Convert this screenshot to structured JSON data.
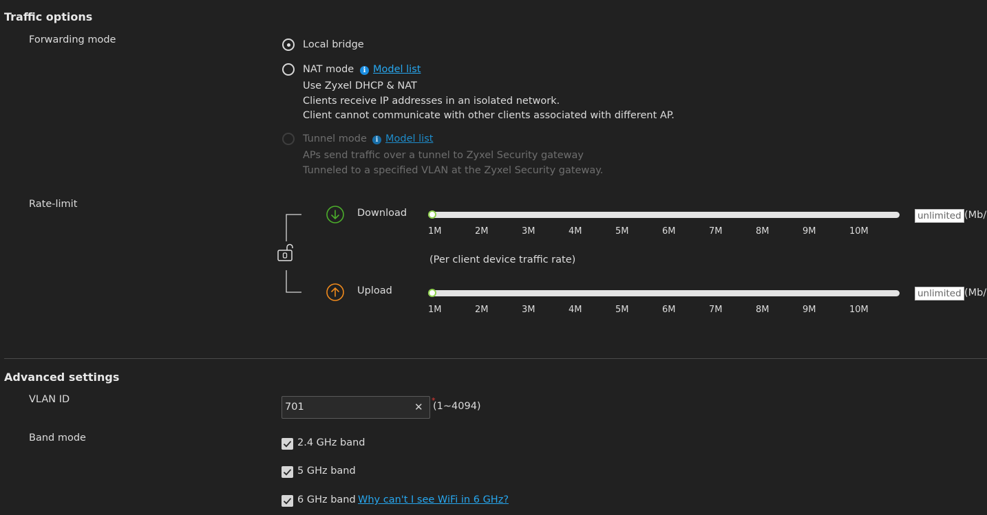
{
  "traffic": {
    "title": "Traffic options",
    "forwarding_label": "Forwarding mode",
    "options": [
      {
        "label": "Local bridge",
        "selected": true,
        "disabled": false
      },
      {
        "label": "NAT mode",
        "link": "Model list",
        "selected": false,
        "disabled": false,
        "desc": [
          "Use Zyxel DHCP & NAT",
          "Clients receive IP addresses in an isolated network.",
          "Client cannot communicate with other clients associated with different AP."
        ]
      },
      {
        "label": "Tunnel mode",
        "link": "Model list",
        "selected": false,
        "disabled": true,
        "desc": [
          "APs send traffic over a tunnel to Zyxel Security gateway",
          "Tunneled to a specified VLAN at the Zyxel Security gateway."
        ]
      }
    ],
    "info_glyph": "i",
    "rate_limit_label": "Rate-limit",
    "download_label": "Download",
    "upload_label": "Upload",
    "ticks": [
      "1M",
      "2M",
      "3M",
      "4M",
      "5M",
      "6M",
      "7M",
      "8M",
      "9M",
      "10M"
    ],
    "download_value": "unlimited",
    "upload_value": "unlimited",
    "download_slider_position": 0,
    "upload_slider_position": 0,
    "unit": "(Mb/",
    "per_client_note": "(Per client device traffic rate)",
    "icons": {
      "download": "download-circle-icon",
      "upload": "upload-circle-icon",
      "link": "unlock-icon"
    },
    "colors": {
      "download": "#4cae2b",
      "upload": "#f08a1c",
      "knob_border": "#8fd14f"
    }
  },
  "advanced": {
    "title": "Advanced settings",
    "vlan_label": "VLAN ID",
    "vlan_value": "701",
    "vlan_required": "*",
    "vlan_range": "(1~4094)",
    "clear_glyph": "✕",
    "band_label": "Band mode",
    "bands": [
      {
        "label": "2.4 GHz band",
        "checked": true
      },
      {
        "label": "5 GHz band",
        "checked": true
      },
      {
        "label": "6 GHz band",
        "checked": true,
        "link": "Why can't I see WiFi in 6 GHz?"
      }
    ]
  }
}
